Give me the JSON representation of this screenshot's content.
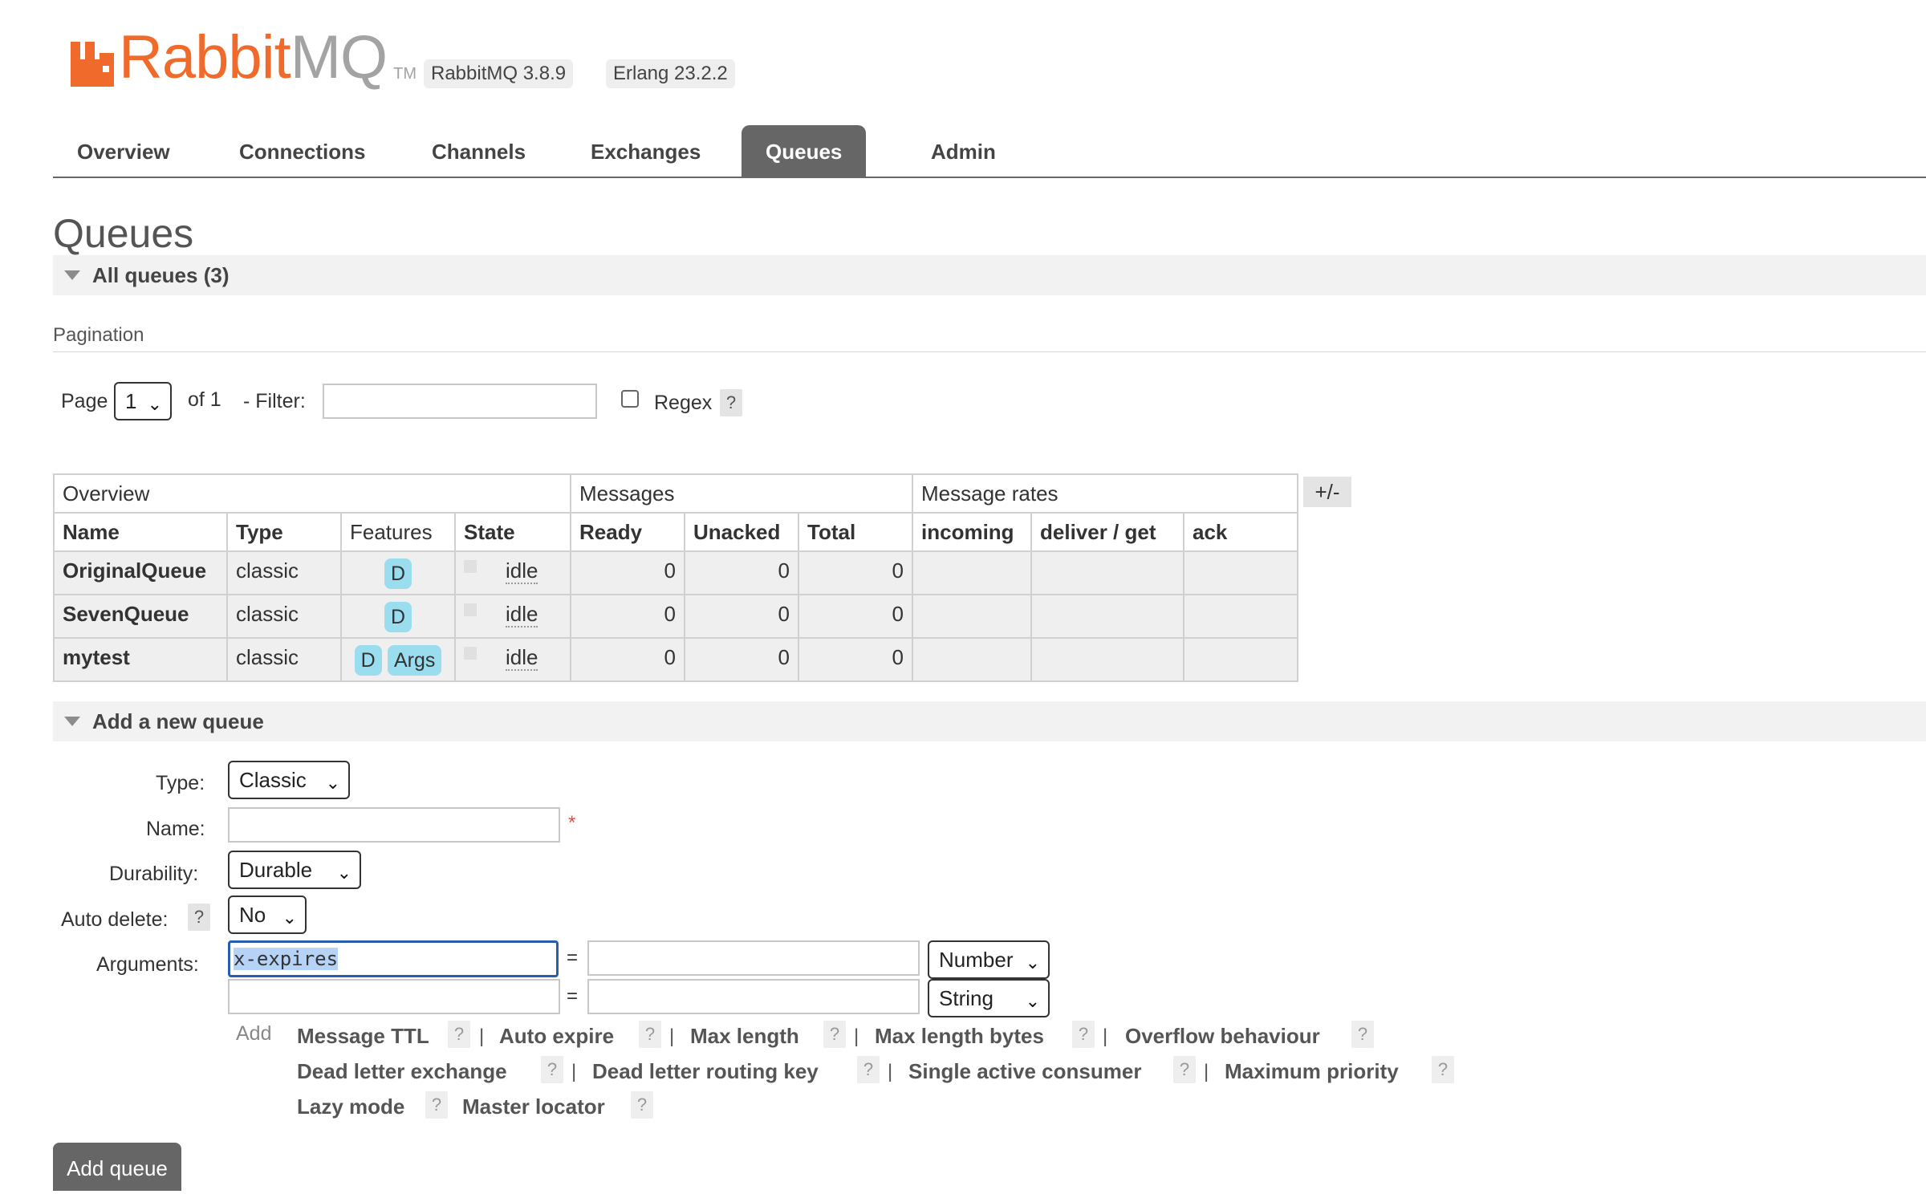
{
  "header": {
    "logo_rabbit": "Rabbit",
    "logo_mq": "MQ",
    "logo_tm": "TM",
    "rabbitmq_version": "RabbitMQ 3.8.9",
    "erlang_version": "Erlang 23.2.2",
    "brand_color": "#f06a2b"
  },
  "nav": {
    "tabs": [
      {
        "label": "Overview"
      },
      {
        "label": "Connections"
      },
      {
        "label": "Channels"
      },
      {
        "label": "Exchanges"
      },
      {
        "label": "Queues",
        "active": true
      },
      {
        "label": "Admin"
      }
    ]
  },
  "page": {
    "title": "Queues"
  },
  "all_queues": {
    "heading": "All queues (3)",
    "pagination_label": "Pagination",
    "page_label": "Page",
    "page_value": "1",
    "of_label": "of 1",
    "filter_label": "- Filter:",
    "filter_value": "",
    "regex_label": "Regex",
    "regex_checked": false,
    "help": "?"
  },
  "table": {
    "group_headers": [
      "Overview",
      "Messages",
      "Message rates"
    ],
    "columns": [
      "Name",
      "Type",
      "Features",
      "State",
      "Ready",
      "Unacked",
      "Total",
      "incoming",
      "deliver / get",
      "ack"
    ],
    "plus_minus": "+/-",
    "rows": [
      {
        "name": "OriginalQueue",
        "type": "classic",
        "features": [
          "D"
        ],
        "state": "idle",
        "ready": "0",
        "unacked": "0",
        "total": "0"
      },
      {
        "name": "SevenQueue",
        "type": "classic",
        "features": [
          "D"
        ],
        "state": "idle",
        "ready": "0",
        "unacked": "0",
        "total": "0"
      },
      {
        "name": "mytest",
        "type": "classic",
        "features": [
          "D",
          "Args"
        ],
        "state": "idle",
        "ready": "0",
        "unacked": "0",
        "total": "0"
      }
    ]
  },
  "add_queue": {
    "heading": "Add a new queue",
    "type_label": "Type:",
    "type_value": "Classic",
    "name_label": "Name:",
    "name_value": "",
    "required_mark": "*",
    "durability_label": "Durability:",
    "durability_value": "Durable",
    "auto_delete_label": "Auto delete:",
    "auto_delete_value": "No",
    "arguments_label": "Arguments:",
    "arg1_key": "x-expires",
    "arg1_value": "",
    "arg1_type": "Number",
    "arg2_key": "",
    "arg2_value": "",
    "arg2_type": "String",
    "eq": "=",
    "add_label": "Add",
    "helpers": [
      "Message TTL",
      "Auto expire",
      "Max length",
      "Max length bytes",
      "Overflow behaviour",
      "Dead letter exchange",
      "Dead letter routing key",
      "Single active consumer",
      "Maximum priority",
      "Lazy mode",
      "Master locator"
    ],
    "separator": "|",
    "submit_label": "Add queue"
  }
}
